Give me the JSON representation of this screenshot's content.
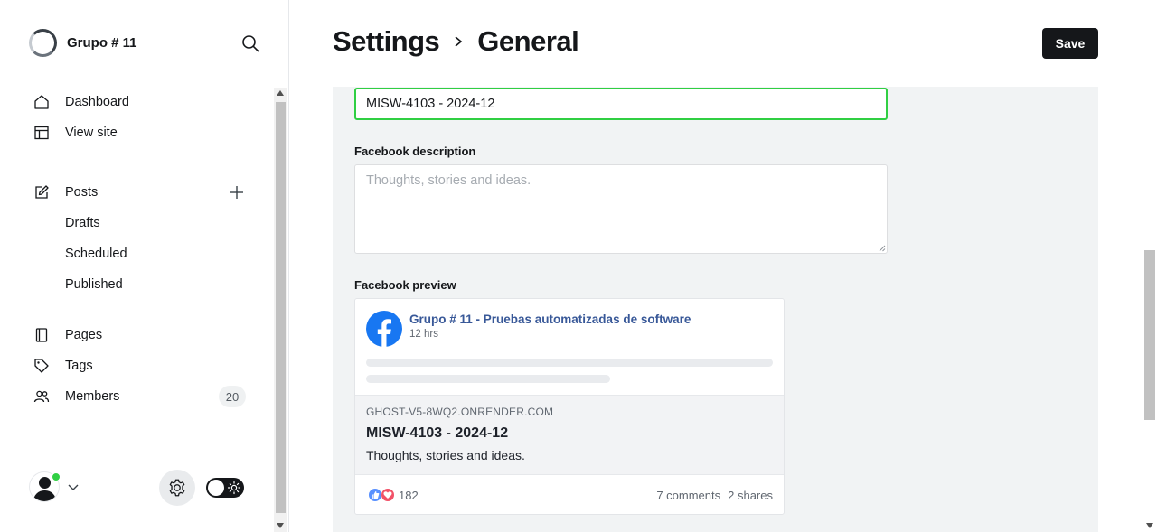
{
  "sidebar": {
    "site_name": "Grupo # 11",
    "nav": [
      {
        "label": "Dashboard",
        "icon": "home-icon"
      },
      {
        "label": "View site",
        "icon": "layout-icon"
      },
      {
        "label": "Posts",
        "icon": "edit-icon"
      },
      {
        "label": "Pages",
        "icon": "page-icon"
      },
      {
        "label": "Tags",
        "icon": "tag-icon"
      },
      {
        "label": "Members",
        "icon": "members-icon"
      }
    ],
    "post_subitems": [
      "Drafts",
      "Scheduled",
      "Published"
    ],
    "members_count": "20"
  },
  "header": {
    "title": "Settings",
    "subtitle": "General",
    "save_label": "Save"
  },
  "form": {
    "facebook_title_value": "MISW-4103 - 2024-12",
    "facebook_description_label": "Facebook description",
    "facebook_description_placeholder": "Thoughts, stories and ideas.",
    "facebook_preview_label": "Facebook preview"
  },
  "preview": {
    "page_name": "Grupo # 11 - Pruebas automatizadas de software",
    "time": "12 hrs",
    "domain": "GHOST-V5-8WQ2.ONRENDER.COM",
    "title": "MISW-4103 - 2024-12",
    "description": "Thoughts, stories and ideas.",
    "reactions_count": "182",
    "comments": "7 comments",
    "shares": "2 shares"
  },
  "colors": {
    "accent_green": "#30cf43",
    "facebook_blue": "#1877f2",
    "dark": "#15171a"
  }
}
